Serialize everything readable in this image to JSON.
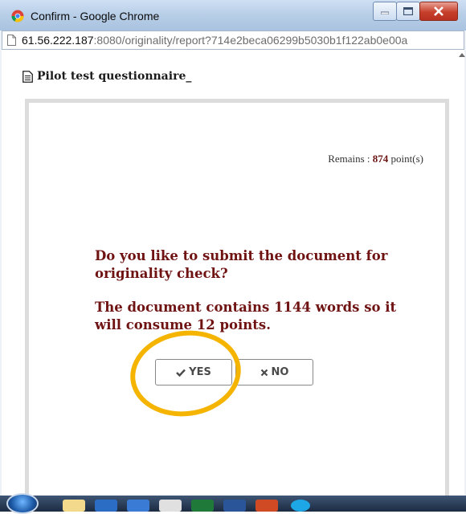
{
  "window": {
    "title": "Confirm - Google Chrome",
    "url_host": "61.56.222.187",
    "url_rest": ":8080/originality/report?714e2beca06299b5030b1f122ab0e00a"
  },
  "page": {
    "heading": "Pilot test questionnaire_",
    "remains_label": "Remains : ",
    "remains_value": "874",
    "remains_unit": " point(s)",
    "question": "Do you like to submit the document for originality check?",
    "detail": "The document contains 1144 words so it will consume 12 points.",
    "yes_label": "YES",
    "no_label": "NO"
  },
  "annotation": {
    "highlight_color": "#f4b400"
  },
  "taskbar": {
    "items": [
      "folder-icon",
      "outlook-icon",
      "explorer-icon",
      "chrome-icon",
      "excel-icon",
      "word-icon",
      "powerpoint-icon",
      "skype-icon"
    ]
  }
}
